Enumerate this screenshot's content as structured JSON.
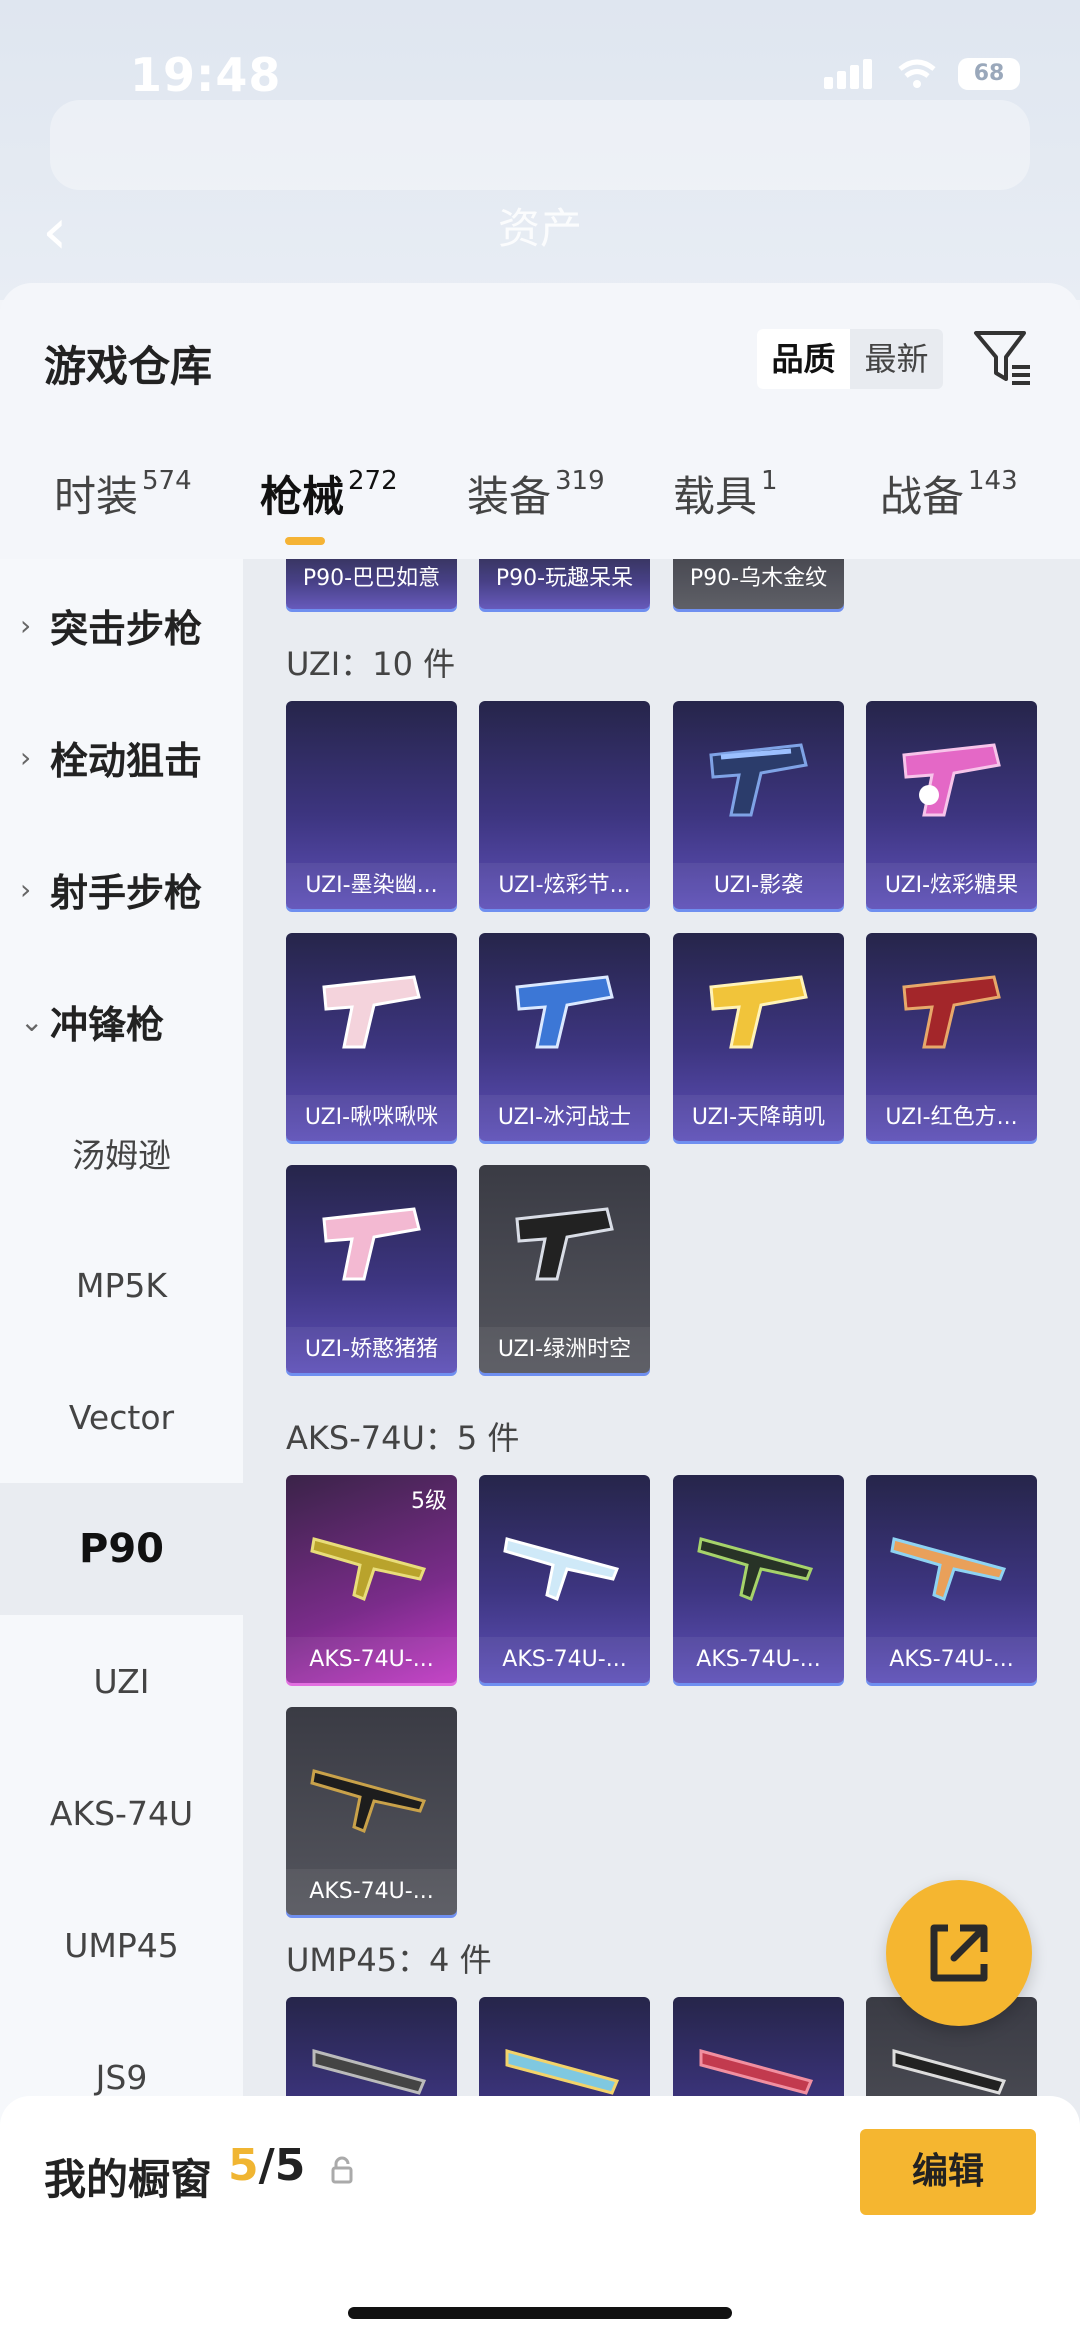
{
  "status": {
    "time": "19:48",
    "battery": "68"
  },
  "header": {
    "back_icon": "chevron-left-icon",
    "title": "资产"
  },
  "sheet": {
    "title": "游戏仓库",
    "sort_options": [
      "品质",
      "最新"
    ],
    "filter_icon": "filter-icon"
  },
  "tabs": [
    {
      "label": "时装",
      "count": "574"
    },
    {
      "label": "枪械",
      "count": "272"
    },
    {
      "label": "装备",
      "count": "319"
    },
    {
      "label": "载具",
      "count": "1"
    },
    {
      "label": "战备",
      "count": "143"
    }
  ],
  "sidebar": {
    "categories": [
      "突击步枪",
      "栓动狙击",
      "射手步枪",
      "冲锋枪"
    ],
    "subitems": [
      "汤姆逊",
      "MP5K",
      "Vector",
      "P90",
      "UZI",
      "AKS-74U",
      "UMP45",
      "JS9"
    ],
    "selected": "P90"
  },
  "content": {
    "p90_top": [
      "P90-巴巴如意",
      "P90-玩趣呆呆",
      "P90-乌木金纹"
    ],
    "uzi": {
      "title": "UZI：10 件",
      "items": [
        "UZI-墨染幽...",
        "UZI-炫彩节...",
        "UZI-影袭",
        "UZI-炫彩糖果",
        "UZI-啾咪啾咪",
        "UZI-冰河战士",
        "UZI-天降萌叽",
        "UZI-红色方...",
        "UZI-娇憨猪猪",
        "UZI-绿洲时空"
      ]
    },
    "aks": {
      "title": "AKS-74U：5 件",
      "level_badge": "5级",
      "items": [
        "AKS-74U-...",
        "AKS-74U-...",
        "AKS-74U-...",
        "AKS-74U-...",
        "AKS-74U-..."
      ]
    },
    "ump": {
      "title": "UMP45：4 件"
    }
  },
  "fab": {
    "icon": "share-external-icon"
  },
  "bottom": {
    "label": "我的橱窗",
    "count_current": "5",
    "count_sep": "/5",
    "lock_icon": "lock-icon",
    "edit_label": "编辑"
  },
  "colors": {
    "accent": "#f5b630",
    "card_purple": "#3d3580",
    "card_highlight": "#6f8ff0"
  }
}
